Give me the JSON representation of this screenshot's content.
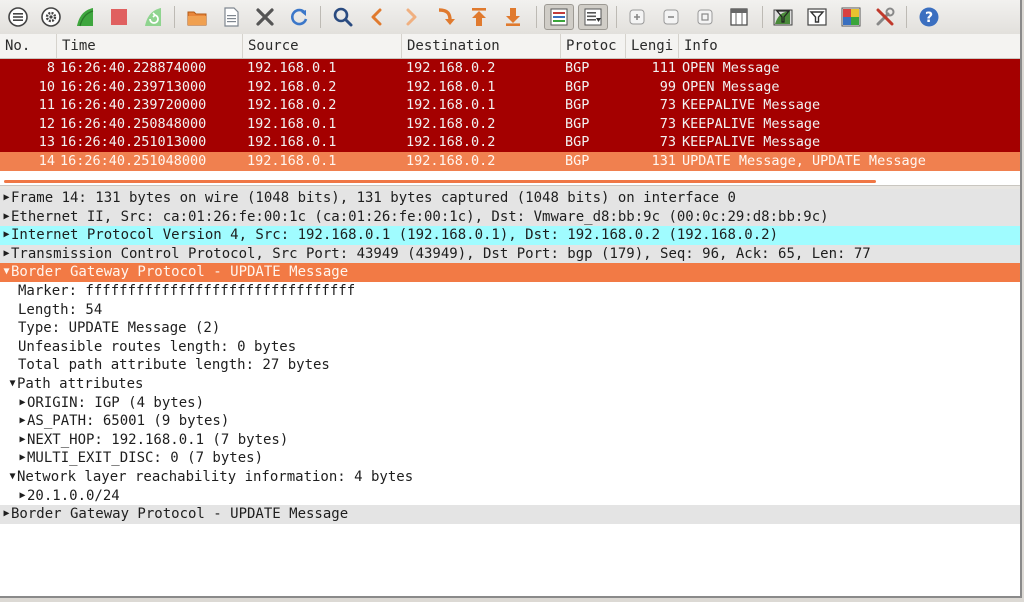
{
  "icons": [
    {
      "name": "interface-list-icon",
      "color": "#404040"
    },
    {
      "name": "capture-options-icon",
      "color": "#404040"
    },
    {
      "name": "start-capture-icon",
      "color": "#3ea63e"
    },
    {
      "name": "stop-capture-icon",
      "color": "#e06060"
    },
    {
      "name": "restart-capture-icon",
      "color": "#6cc26c"
    },
    {
      "name": "open-file-icon",
      "color": "#e07a2e"
    },
    {
      "name": "save-file-icon",
      "color": "#9aa0a8"
    },
    {
      "name": "close-file-icon",
      "color": "#555555"
    },
    {
      "name": "reload-icon",
      "color": "#3b77c9"
    },
    {
      "name": "find-packet-icon",
      "color": "#2a4b80"
    },
    {
      "name": "go-back-icon",
      "color": "#e07a2e"
    },
    {
      "name": "go-forward-icon",
      "color": "#e07a2e"
    },
    {
      "name": "go-to-packet-icon",
      "color": "#e07a2e"
    },
    {
      "name": "first-packet-icon",
      "color": "#e07a2e"
    },
    {
      "name": "last-packet-icon",
      "color": "#e07a2e"
    },
    {
      "name": "colorize-icon",
      "color": "#3a6fbf"
    },
    {
      "name": "auto-scroll-icon",
      "color": "#555555"
    },
    {
      "name": "zoom-in-icon",
      "color": "#888888"
    },
    {
      "name": "zoom-out-icon",
      "color": "#888888"
    },
    {
      "name": "normal-size-icon",
      "color": "#888888"
    },
    {
      "name": "resize-columns-icon",
      "color": "#555555"
    },
    {
      "name": "capture-filters-icon",
      "color": "#4a8a3a"
    },
    {
      "name": "display-filters-icon",
      "color": "#555555"
    },
    {
      "name": "coloring-rules-icon",
      "color": "#d94040"
    },
    {
      "name": "preferences-icon",
      "color": "#c0392b"
    },
    {
      "name": "help-icon",
      "color": "#3b6fc0"
    }
  ],
  "packet_list": {
    "columns": [
      "No.",
      "Time",
      "Source",
      "Destination",
      "Protoc",
      "Lengi",
      "Info"
    ],
    "rows": [
      {
        "no": "8",
        "time": "16:26:40.228874000",
        "source": "192.168.0.1",
        "destination": "192.168.0.2",
        "protocol": "BGP",
        "length": "111",
        "info": "OPEN Message",
        "selected": false
      },
      {
        "no": "10",
        "time": "16:26:40.239713000",
        "source": "192.168.0.2",
        "destination": "192.168.0.1",
        "protocol": "BGP",
        "length": "99",
        "info": "OPEN Message",
        "selected": false
      },
      {
        "no": "11",
        "time": "16:26:40.239720000",
        "source": "192.168.0.2",
        "destination": "192.168.0.1",
        "protocol": "BGP",
        "length": "73",
        "info": "KEEPALIVE Message",
        "selected": false
      },
      {
        "no": "12",
        "time": "16:26:40.250848000",
        "source": "192.168.0.1",
        "destination": "192.168.0.2",
        "protocol": "BGP",
        "length": "73",
        "info": "KEEPALIVE Message",
        "selected": false
      },
      {
        "no": "13",
        "time": "16:26:40.251013000",
        "source": "192.168.0.1",
        "destination": "192.168.0.2",
        "protocol": "BGP",
        "length": "73",
        "info": "KEEPALIVE Message",
        "selected": false
      },
      {
        "no": "14",
        "time": "16:26:40.251048000",
        "source": "192.168.0.1",
        "destination": "192.168.0.2",
        "protocol": "BGP",
        "length": "131",
        "info": "UPDATE Message, UPDATE Message",
        "selected": true
      }
    ]
  },
  "details": [
    {
      "text": "Frame 14: 131 bytes on wire (1048 bits), 131 bytes captured (1048 bits) on interface 0",
      "arrow": "right",
      "level": 0,
      "style": "gray"
    },
    {
      "text": "Ethernet II, Src: ca:01:26:fe:00:1c (ca:01:26:fe:00:1c), Dst: Vmware_d8:bb:9c (00:0c:29:d8:bb:9c)",
      "arrow": "right",
      "level": 0,
      "style": "gray"
    },
    {
      "text": "Internet Protocol Version 4, Src: 192.168.0.1 (192.168.0.1), Dst: 192.168.0.2 (192.168.0.2)",
      "arrow": "right",
      "level": 0,
      "style": "cyan"
    },
    {
      "text": "Transmission Control Protocol, Src Port: 43949 (43949), Dst Port: bgp (179), Seq: 96, Ack: 65, Len: 77",
      "arrow": "right",
      "level": 0,
      "style": "gray"
    },
    {
      "text": "Border Gateway Protocol - UPDATE Message",
      "arrow": "down",
      "level": 0,
      "style": "orange"
    },
    {
      "text": "Marker: ffffffffffffffffffffffffffffffff",
      "arrow": "none",
      "level": 1,
      "style": "plain"
    },
    {
      "text": "Length: 54",
      "arrow": "none",
      "level": 1,
      "style": "plain"
    },
    {
      "text": "Type: UPDATE Message (2)",
      "arrow": "none",
      "level": 1,
      "style": "plain"
    },
    {
      "text": "Unfeasible routes length: 0 bytes",
      "arrow": "none",
      "level": 1,
      "style": "plain"
    },
    {
      "text": "Total path attribute length: 27 bytes",
      "arrow": "none",
      "level": 1,
      "style": "plain"
    },
    {
      "text": "Path attributes",
      "arrow": "down",
      "level": 0.5,
      "style": "plain"
    },
    {
      "text": "ORIGIN: IGP (4 bytes)",
      "arrow": "right",
      "level": 1,
      "style": "plain"
    },
    {
      "text": "AS_PATH: 65001 (9 bytes)",
      "arrow": "right",
      "level": 1,
      "style": "plain"
    },
    {
      "text": "NEXT_HOP: 192.168.0.1 (7 bytes)",
      "arrow": "right",
      "level": 1,
      "style": "plain"
    },
    {
      "text": "MULTI_EXIT_DISC: 0 (7 bytes)",
      "arrow": "right",
      "level": 1,
      "style": "plain"
    },
    {
      "text": "Network layer reachability information: 4 bytes",
      "arrow": "down",
      "level": 0.5,
      "style": "plain"
    },
    {
      "text": "20.1.0.0/24",
      "arrow": "right",
      "level": 1,
      "style": "plain"
    },
    {
      "text": "Border Gateway Protocol - UPDATE Message",
      "arrow": "right",
      "level": 0,
      "style": "gray"
    }
  ]
}
